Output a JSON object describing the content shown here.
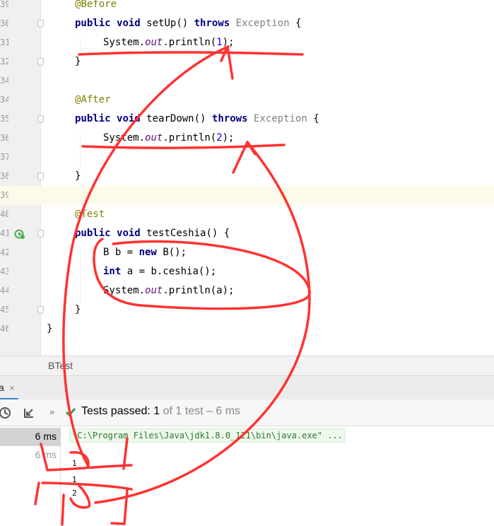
{
  "editor": {
    "lines": [
      {
        "num": "39"
      },
      {
        "num": "30"
      },
      {
        "num": "31"
      },
      {
        "num": "32"
      },
      {
        "num": "34"
      },
      {
        "num": "35"
      },
      {
        "num": "36"
      },
      {
        "num": "37"
      },
      {
        "num": "38"
      },
      {
        "num": "39"
      },
      {
        "num": "40"
      },
      {
        "num": "41"
      },
      {
        "num": "42"
      },
      {
        "num": "43"
      },
      {
        "num": "44"
      },
      {
        "num": "45"
      },
      {
        "num": "46"
      }
    ],
    "code": {
      "before": "@Before",
      "public": "public",
      "void": "void",
      "setup": "setUp()",
      "throws": "throws",
      "exception": "Exception",
      "brace_open": "{",
      "brace_close": "}",
      "system": "System.",
      "out": "out",
      "println_open": ".println(",
      "close_paren": ");",
      "one": "1",
      "two": "2",
      "after": "@After",
      "teardown": "tearDown()",
      "test": "@Test",
      "testceshia": "testCeshia()",
      "b_decl": "B b = ",
      "new": "new",
      "b_ctor": "B();",
      "int": "int",
      "a_decl": "a = b.ceshia();",
      "println_a": ".println(a);"
    }
  },
  "tool_window": {
    "file_tab": "BTest",
    "run_tab": "a",
    "run_tab_close": "×",
    "more": "»",
    "status_main": "Tests passed: ",
    "status_count": "1",
    "status_rest": "of 1 test – 6 ms",
    "tree": [
      {
        "time": "6 ms"
      },
      {
        "time": "6 ms"
      }
    ],
    "command": "\"C:\\Program Files\\Java\\jdk1.8.0_121\\bin\\java.exe\" ...",
    "output": [
      "1",
      "1",
      "2"
    ]
  },
  "colors": {
    "keyword": "#000080",
    "annotation": "#808000",
    "number": "#0000ff",
    "field": "#660e7a",
    "pass_green": "#3c9a3c",
    "scribble_red": "#ff3333"
  }
}
